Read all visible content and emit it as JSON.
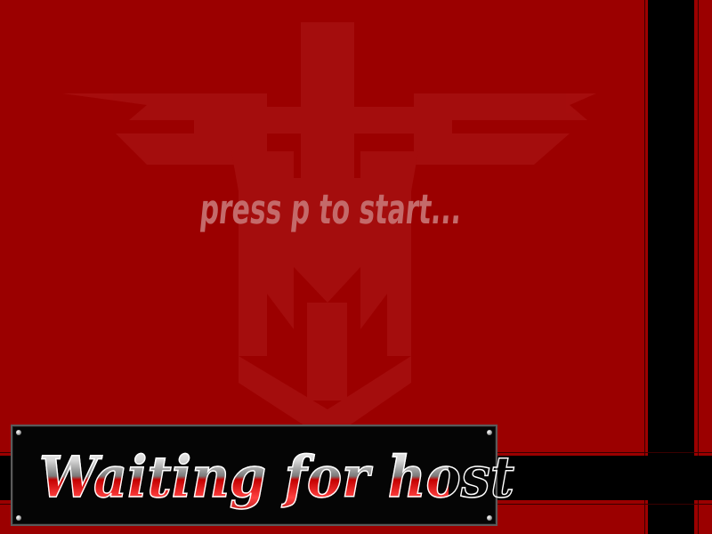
{
  "screen": {
    "prompt_text": "press p to start...",
    "status_banner": "Waiting for host"
  },
  "colors": {
    "background": "#9b0000",
    "emblem": "#a81212",
    "bars": "#000000",
    "prompt": "#c46a6a"
  },
  "icons": {
    "emblem": "eagle-emblem-icon"
  }
}
